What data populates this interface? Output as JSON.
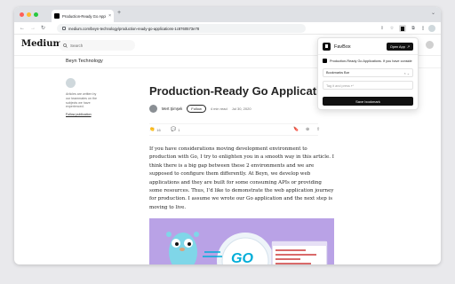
{
  "browser": {
    "tab_title": "Production-Ready Go Appl...",
    "tab_close": "×",
    "new_tab": "+",
    "url": "medium.com/beyn-technology/production-ready-go-applications-1c8760573e78",
    "back": "←",
    "forward": "→",
    "reload": "↻"
  },
  "header": {
    "logo": "Medium",
    "search_placeholder": "Search"
  },
  "publication": {
    "name": "Beyn Technology",
    "description": "Articles are written by our teammates on the subjects we have experienced.",
    "follow_label": "Follow publication"
  },
  "article": {
    "title": "Production-Ready Go Application",
    "author": "Mert Şimşek",
    "follow": "Follow",
    "read_time": "4 min read",
    "date": "Jul 30, 2020",
    "claps": "16",
    "comments": "1",
    "paragraph": "If you have considerations moving development environment to production with Go, I try to enlighten you in a smooth way in this article. I think there is a big gap between these 2 environments and we are supposed to configure them differently. At Beyn, we develop web applications and they are built for some consuming APIs or providing some resources. Thus, I’d like to demonstrate the web application journey for production. I assume we wrote our Go application and the next step is moving to live.",
    "hero_text": "GO"
  },
  "popup": {
    "app_name": "FavBox",
    "open_app": "Open App",
    "page_title": "Production-Ready Go Applications. If you have conside",
    "folder": "Bookmarks Bar",
    "folder_clear": "× ⌄",
    "tags_placeholder": "Tag it and press ↵",
    "save": "Save bookmark"
  },
  "colors": {
    "hero_bg": "#b9a2e6",
    "go_blue": "#00add8",
    "gopher": "#7fd6e8"
  }
}
